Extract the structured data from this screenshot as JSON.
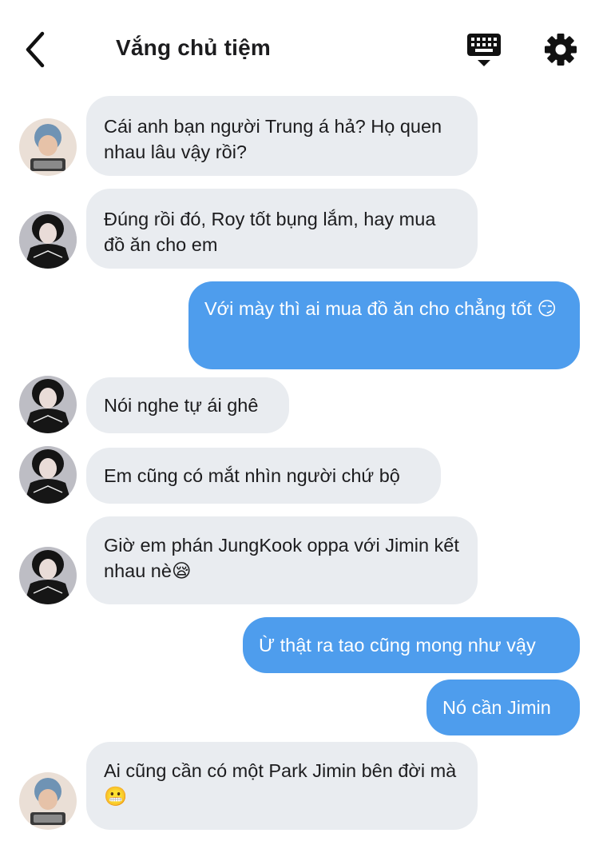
{
  "header": {
    "title": "Vắng chủ tiệm",
    "back_icon": "chevron-left-icon",
    "keyboard_icon": "keyboard-icon",
    "settings_icon": "gear-icon"
  },
  "messages": [
    {
      "sender": "other",
      "avatar": "avatar-blue",
      "text": "Cái anh bạn người Trung á hả? Họ quen nhau lâu vậy rồi?"
    },
    {
      "sender": "other",
      "avatar": "avatar-dark",
      "text": "Đúng rồi đó, Roy tốt bụng lắm, hay mua đồ ăn cho em"
    },
    {
      "sender": "me",
      "text": "Với mày thì ai mua đồ ăn cho chẳng tốt 😏"
    },
    {
      "sender": "other",
      "avatar": "avatar-dark",
      "text": "Nói nghe tự ái ghê"
    },
    {
      "sender": "other",
      "avatar": "avatar-dark",
      "text": "Em cũng có mắt nhìn người chứ bộ"
    },
    {
      "sender": "other",
      "avatar": "avatar-dark",
      "text": "Giờ em phán JungKook oppa với Jimin kết nhau nè😪"
    },
    {
      "sender": "me",
      "text": "Ừ thật ra tao cũng mong như vậy"
    },
    {
      "sender": "me",
      "text": "Nó cần Jimin"
    },
    {
      "sender": "other",
      "avatar": "avatar-blue",
      "text": "Ai cũng cần có một Park Jimin bên đời mà😬"
    }
  ],
  "colors": {
    "incoming_bubble": "#e9ecf0",
    "outgoing_bubble": "#4e9ded"
  }
}
